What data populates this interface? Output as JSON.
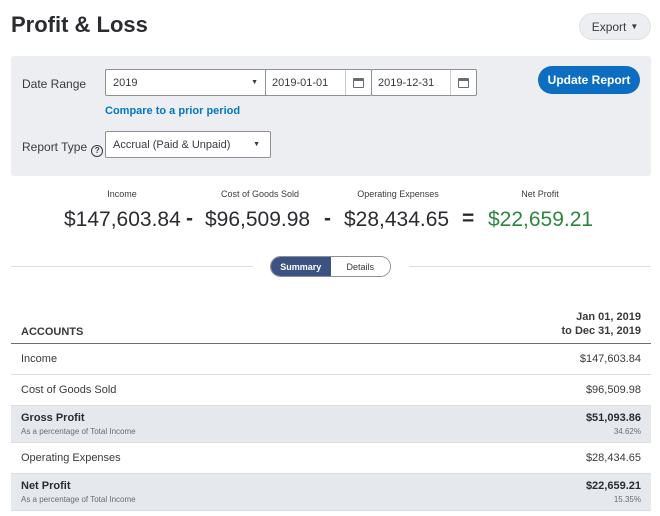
{
  "header": {
    "title": "Profit & Loss",
    "export_label": "Export"
  },
  "filters": {
    "date_range_label": "Date Range",
    "date_range_value": "2019",
    "start_date": "2019-01-01",
    "end_date": "2019-12-31",
    "compare_link": "Compare to a prior period",
    "report_type_label": "Report Type",
    "report_type_value": "Accrual (Paid & Unpaid)",
    "update_button": "Update Report"
  },
  "summary": {
    "income_label": "Income",
    "income_value": "$147,603.84",
    "cogs_label": "Cost of Goods Sold",
    "cogs_value": "$96,509.98",
    "opex_label": "Operating Expenses",
    "opex_value": "$28,434.65",
    "net_label": "Net Profit",
    "net_value": "$22,659.21",
    "op_minus": "-",
    "op_equals": "=",
    "net_color": "#2e8540"
  },
  "view_toggle": {
    "summary": "Summary",
    "details": "Details",
    "active": "Summary"
  },
  "table": {
    "accounts_header": "ACCOUNTS",
    "period_line1": "Jan 01, 2019",
    "period_line2": "to Dec 31, 2019",
    "rows": [
      {
        "name": "Income",
        "amount": "$147,603.84"
      },
      {
        "name": "Cost of Goods Sold",
        "amount": "$96,509.98"
      },
      {
        "name": "Gross Profit",
        "sub": "As a percentage of Total Income",
        "amount": "$51,093.86",
        "pct": "34.62%"
      },
      {
        "name": "Operating Expenses",
        "amount": "$28,434.65"
      },
      {
        "name": "Net Profit",
        "sub": "As a percentage of Total Income",
        "amount": "$22,659.21",
        "pct": "15.35%"
      }
    ]
  },
  "colors": {
    "primary_button": "#0d6ec1",
    "toggle_active": "#3b5283",
    "link": "#0077c5"
  },
  "icons": {
    "export_caret": "caret-down-icon",
    "calendar": "calendar-icon",
    "help": "help-icon"
  }
}
